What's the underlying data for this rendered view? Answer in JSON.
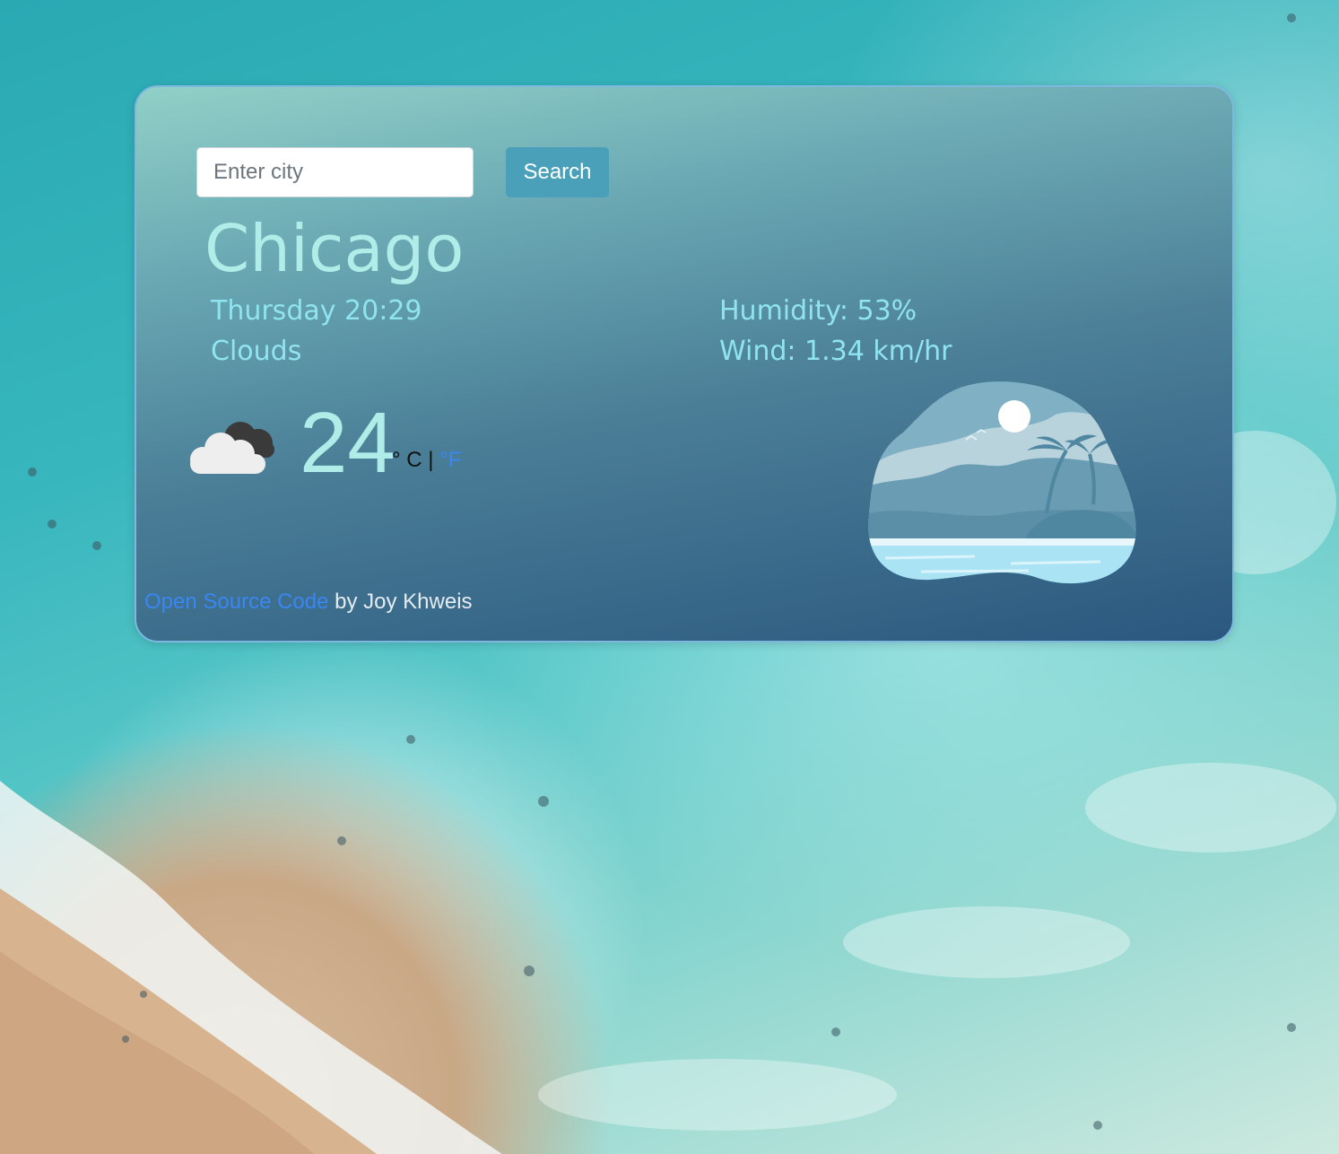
{
  "search": {
    "placeholder": "Enter city",
    "button_label": "Search"
  },
  "weather": {
    "city": "Chicago",
    "datetime": "Thursday 20:29",
    "description": "Clouds",
    "humidity": "Humidity: 53%",
    "wind": "Wind: 1.34 km/hr",
    "temperature": "24",
    "unit_celsius": "° C",
    "unit_separator": "|",
    "unit_fahrenheit": "°F",
    "icon": "cloud-icon"
  },
  "footer": {
    "link_text": "Open Source Code",
    "author_text": " by Joy Khweis"
  },
  "colors": {
    "accent_text": "#b0ece8",
    "detail_text": "#8fe4f0",
    "button": "#4aa0b8",
    "link": "#3a86f2"
  }
}
